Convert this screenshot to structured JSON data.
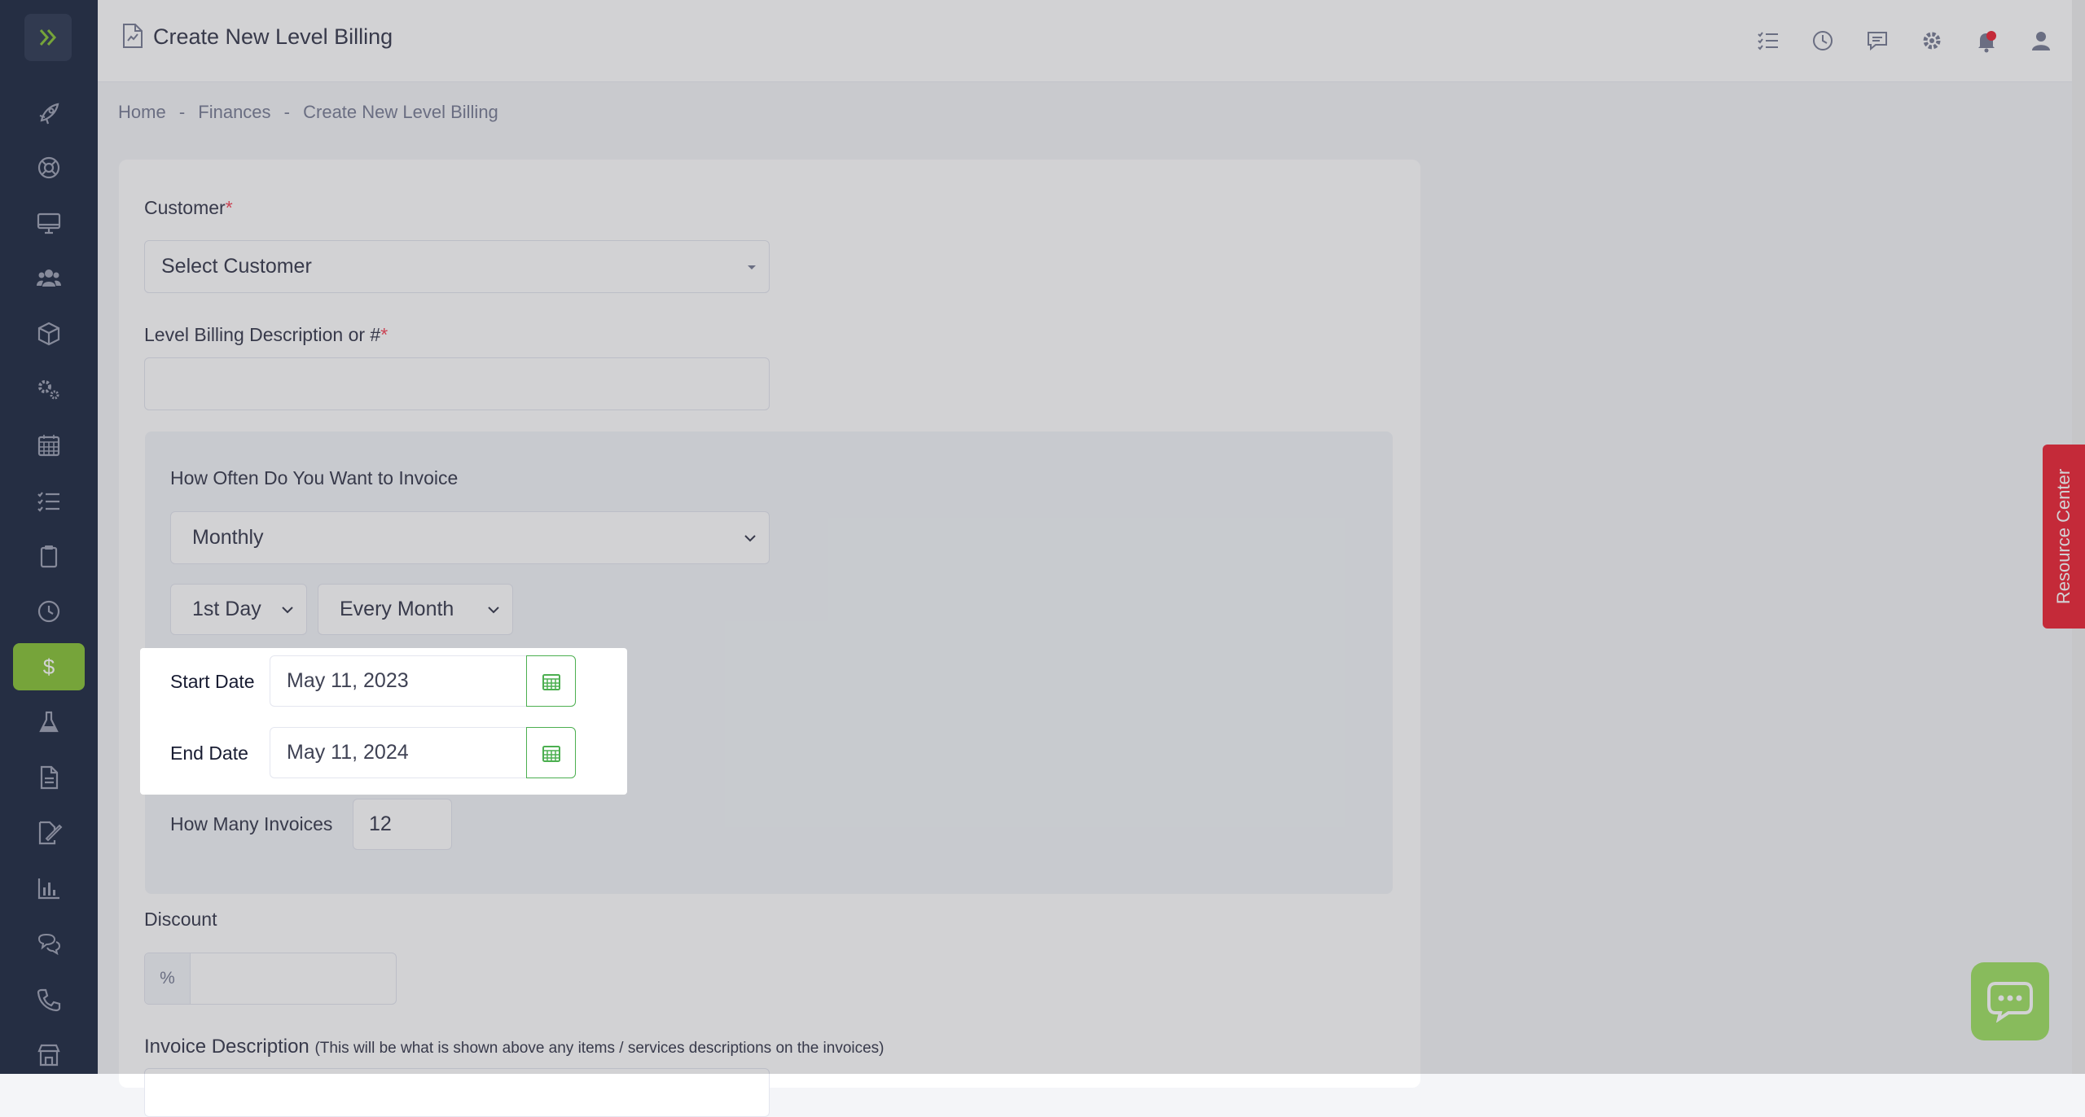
{
  "header": {
    "title": "Create New Level Billing"
  },
  "breadcrumb": {
    "items": [
      "Home",
      "-",
      "Finances",
      "-",
      "Create New Level Billing"
    ]
  },
  "form": {
    "customer_label": "Customer",
    "required_mark": "*",
    "customer_placeholder": "Select Customer",
    "description_label": "Level Billing Description or #",
    "description_value": "",
    "frequency_label": "How Often Do You Want to Invoice",
    "frequency_value": "Monthly",
    "day_value": "1st Day",
    "interval_value": "Every Month",
    "start_date_label": "Start Date",
    "start_date_value": "May 11, 2023",
    "end_date_label": "End Date",
    "end_date_value": "May 11, 2024",
    "invoice_count_label": "How Many Invoices",
    "invoice_count_value": "12",
    "discount_label": "Discount",
    "discount_prefix": "%",
    "discount_value": "",
    "invoice_description_label": "Invoice Description",
    "invoice_description_note": "(This will be what is shown above any items / services descriptions on the invoices)"
  },
  "resource_center": {
    "label": "Resource Center"
  },
  "colors": {
    "accent_green": "#8cc63f",
    "sidebar_bg": "#27324a",
    "resource_red": "#ee2d3e",
    "chat_green": "#a3e36a"
  },
  "sidebar": {
    "icons": [
      "rocket-icon",
      "lifebuoy-icon",
      "monitor-icon",
      "users-icon",
      "cube-icon",
      "gears-icon",
      "calendar-icon",
      "tasks-icon",
      "clipboard-icon",
      "clock-icon",
      "dollar-icon",
      "flask-icon",
      "document-icon",
      "signature-icon",
      "chart-icon",
      "chat-icon",
      "phone-icon",
      "store-icon"
    ]
  }
}
